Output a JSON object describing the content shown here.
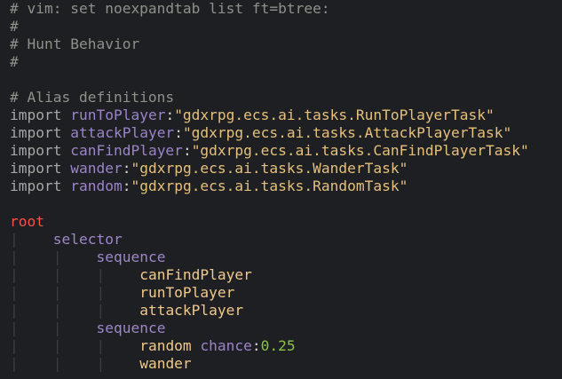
{
  "lines": {
    "l1": "# vim: set noexpandtab list ft=btree:",
    "l2": "#",
    "l3": "# Hunt Behavior",
    "l4": "#",
    "l6": "# Alias definitions",
    "imports": [
      {
        "kw": "import",
        "name": "runToPlayer",
        "value": "\"gdxrpg.ecs.ai.tasks.RunToPlayerTask\""
      },
      {
        "kw": "import",
        "name": "attackPlayer",
        "value": "\"gdxrpg.ecs.ai.tasks.AttackPlayerTask\""
      },
      {
        "kw": "import",
        "name": "canFindPlayer",
        "value": "\"gdxrpg.ecs.ai.tasks.CanFindPlayerTask\""
      },
      {
        "kw": "import",
        "name": "wander",
        "value": "\"gdxrpg.ecs.ai.tasks.WanderTask\""
      },
      {
        "kw": "import",
        "name": "random",
        "value": "\"gdxrpg.ecs.ai.tasks.RandomTask\""
      }
    ],
    "tree": {
      "root": "root",
      "selector": "selector",
      "sequence1": "sequence",
      "canFindPlayer": "canFindPlayer",
      "runToPlayer": "runToPlayer",
      "attackPlayer": "attackPlayer",
      "sequence2": "sequence",
      "random": "random",
      "chance_attr": "chance",
      "chance_value": "0.25",
      "wander": "wander"
    },
    "guide_char": "|"
  }
}
